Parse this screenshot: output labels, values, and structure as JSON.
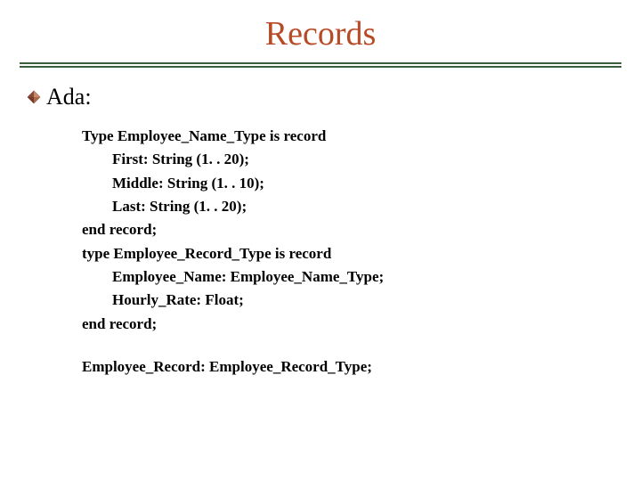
{
  "title": "Records",
  "bullet": "Ada:",
  "code": {
    "l1": "Type Employee_Name_Type is record",
    "l2": "First: String (1. . 20);",
    "l3": "Middle: String (1. . 10);",
    "l4": "Last: String (1. . 20);",
    "l5": "end record;",
    "l6": "type Employee_Record_Type is record",
    "l7": "Employee_Name: Employee_Name_Type;",
    "l8": "Hourly_Rate: Float;",
    "l9": "end record;",
    "l10": "Employee_Record: Employee_Record_Type;"
  }
}
